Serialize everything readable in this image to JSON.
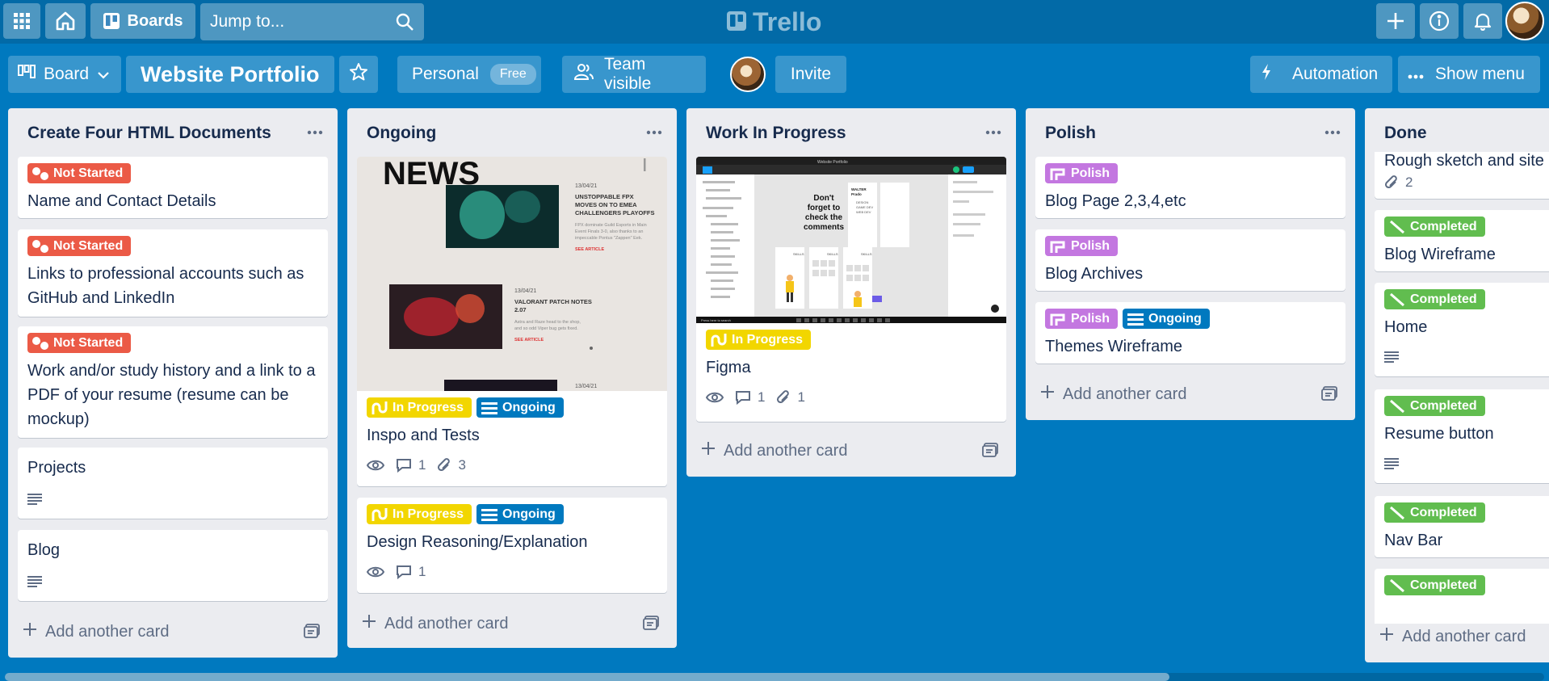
{
  "topbar": {
    "boards_label": "Boards",
    "search_placeholder": "Jump to...",
    "logo_text": "Trello",
    "icons": [
      "apps-grid-icon",
      "home-icon",
      "boards-icon",
      "search-icon",
      "plus-icon",
      "info-icon",
      "bell-icon"
    ]
  },
  "board_header": {
    "view_label": "Board",
    "title": "Website Portfolio",
    "workspace_label": "Personal",
    "workspace_badge": "Free",
    "visibility_label": "Team visible",
    "invite_label": "Invite",
    "automation_label": "Automation",
    "show_menu_label": "Show menu"
  },
  "colors": {
    "background": "#0079bf",
    "topbar": "#026aa7",
    "list": "#ebecf0",
    "label_red": "#eb5a46",
    "label_yellow": "#f2d600",
    "label_blue": "#0079bf",
    "label_purple": "#c377e0",
    "label_green": "#61bd4f"
  },
  "add_card_label": "Add another card",
  "lists": [
    {
      "title": "Create Four HTML Documents",
      "cards": [
        {
          "labels": [
            "Not Started"
          ],
          "title": "Name and Contact Details"
        },
        {
          "labels": [
            "Not Started"
          ],
          "title": "Links to professional accounts such as GitHub and LinkedIn"
        },
        {
          "labels": [
            "Not Started"
          ],
          "title": "Work and/or study history and a link to a PDF of your resume (resume can be mockup)"
        },
        {
          "title": "Projects",
          "has_description": true
        },
        {
          "title": "Blog",
          "has_description": true
        }
      ]
    },
    {
      "title": "Ongoing",
      "cards": [
        {
          "cover": {
            "headline": "NEWS",
            "date1": "13/04/21",
            "story1": "UNSTOPPABLE FPX MOVES ON TO EMEA CHALLENGERS PLAYOFFS",
            "body1": "FPX dominate Guild Esports in Main Event Finals 3-0, also thanks to an impeccable Pontus \"Zappen\" Eek.",
            "link1": "SEE ARTICLE",
            "date2": "13/04/21",
            "story2": "VALORANT PATCH NOTES 2.07",
            "body2": "Astra and Raze head to the shop, and so odd Viper bug gets fixed.",
            "link2": "SEE ARTICLE",
            "date3": "13/04/21"
          },
          "labels": [
            "In Progress",
            "Ongoing"
          ],
          "title": "Inspo and Tests",
          "badges": {
            "comments": "1",
            "attachments": "3"
          }
        },
        {
          "labels": [
            "In Progress",
            "Ongoing"
          ],
          "title": "Design Reasoning/Explanation",
          "badges": {
            "comments": "1"
          }
        }
      ]
    },
    {
      "title": "Work In Progress",
      "cards": [
        {
          "cover": {
            "callout": "Don't forget to check the comments",
            "tab_label": "Website Portfolio",
            "heading": "WALTER Prado",
            "subheading": "DESIGN GAME DEV WEB DEV",
            "skills": "SKILLS",
            "bottom_label": "Press here to search"
          },
          "labels": [
            "In Progress"
          ],
          "title": "Figma",
          "badges": {
            "comments": "1",
            "attachments": "1"
          }
        }
      ]
    },
    {
      "title": "Polish",
      "cards": [
        {
          "labels": [
            "Polish"
          ],
          "title": "Blog Page 2,3,4,etc"
        },
        {
          "labels": [
            "Polish"
          ],
          "title": "Blog Archives"
        },
        {
          "labels": [
            "Polish",
            "Ongoing"
          ],
          "title": "Themes Wireframe"
        }
      ]
    },
    {
      "title": "Done",
      "cards": [
        {
          "title": "Rough sketch and site",
          "badges": {
            "attachments": "2"
          }
        },
        {
          "labels": [
            "Completed"
          ],
          "title": "Blog Wireframe"
        },
        {
          "labels": [
            "Completed"
          ],
          "title": "Home",
          "has_description": true
        },
        {
          "labels": [
            "Completed"
          ],
          "title": "Resume button",
          "has_description": true
        },
        {
          "labels": [
            "Completed"
          ],
          "title": "Nav Bar"
        },
        {
          "labels": [
            "Completed"
          ]
        }
      ]
    }
  ]
}
